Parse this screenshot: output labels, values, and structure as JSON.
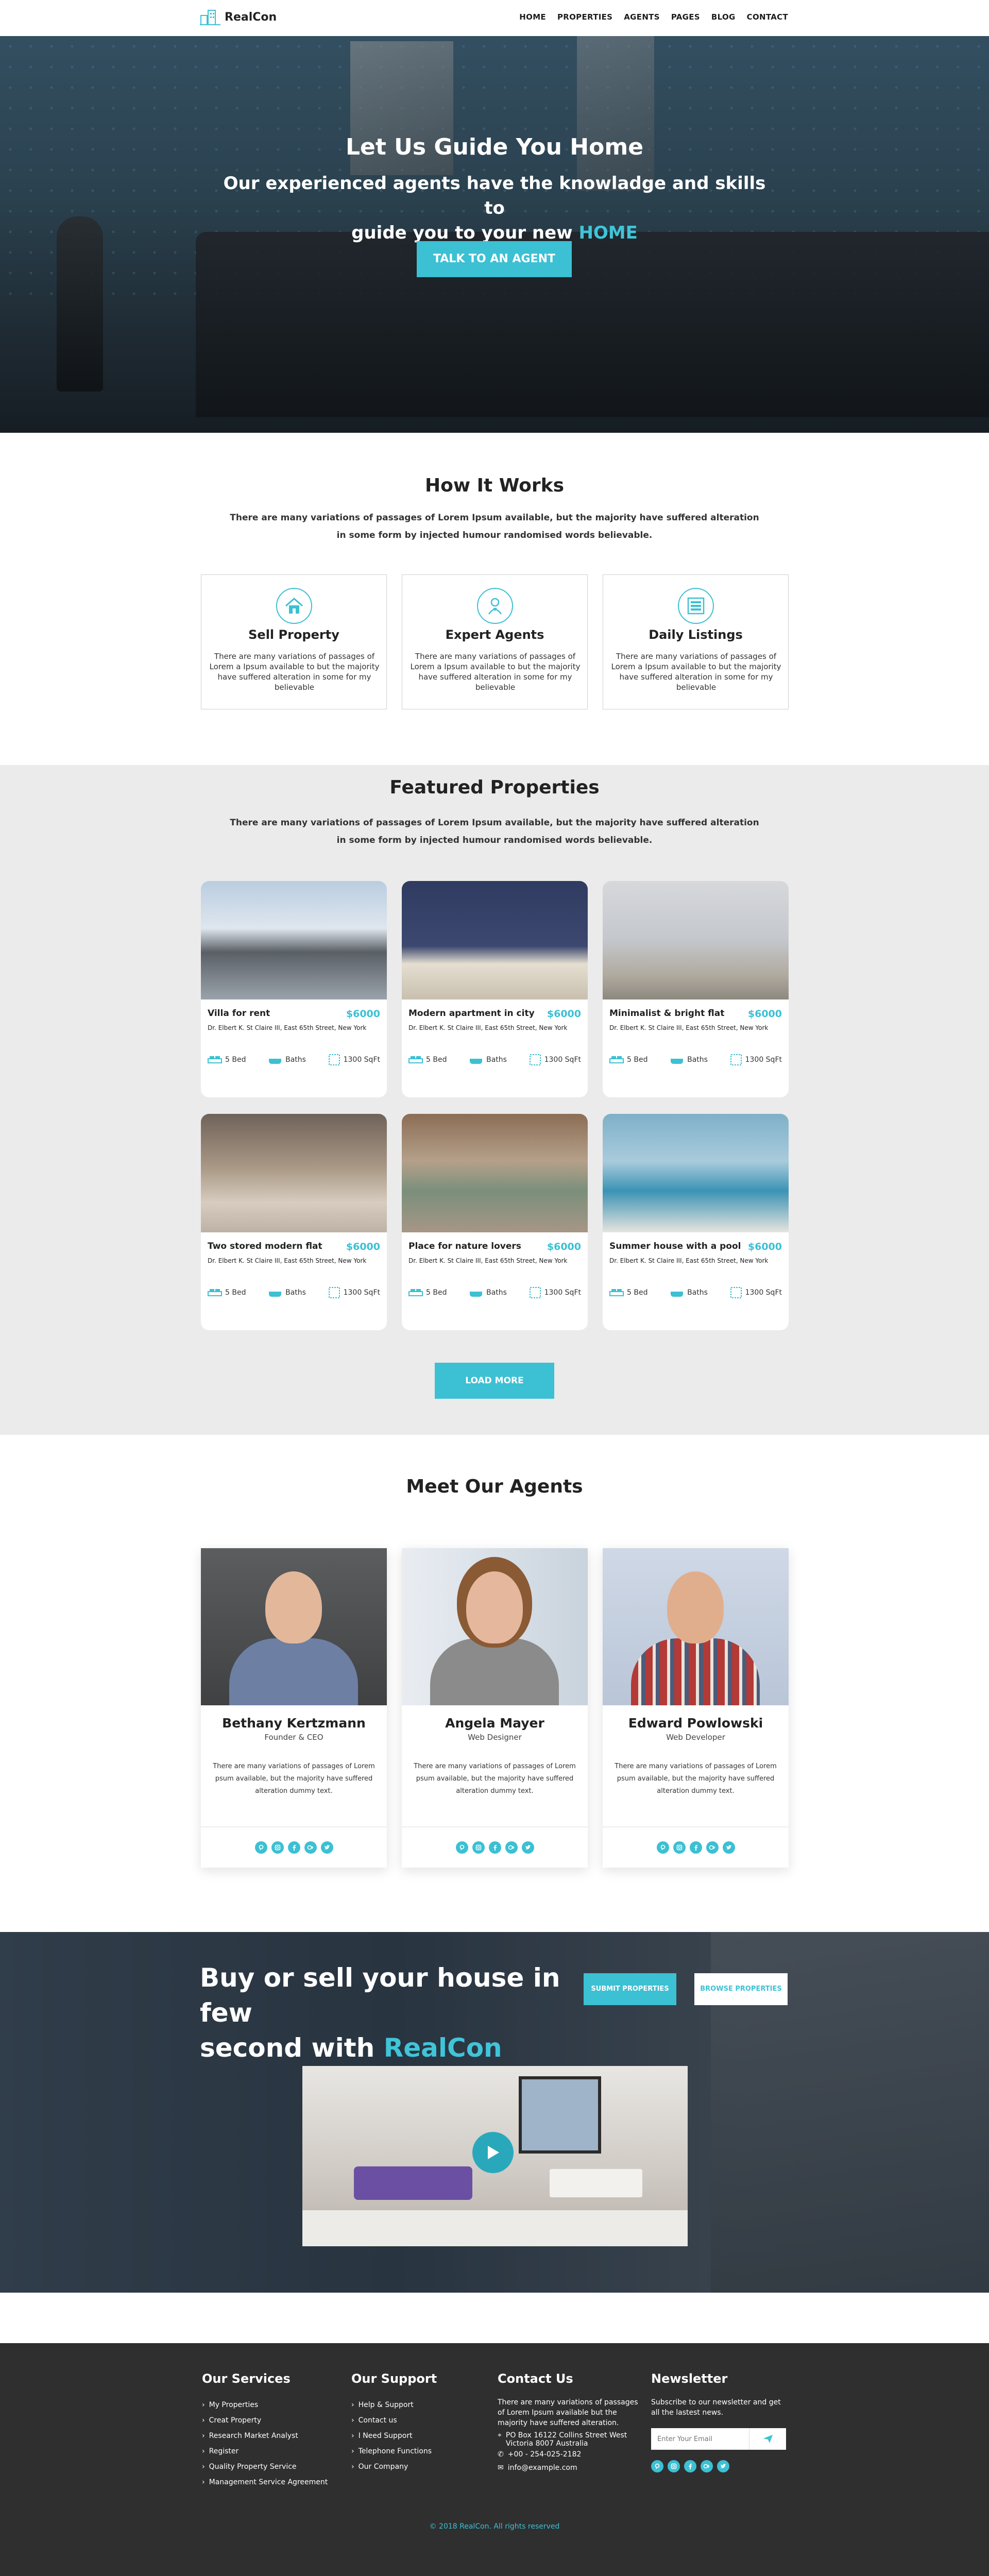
{
  "nav": {
    "brand": "RealCon",
    "items": [
      "HOME",
      "PROPERTIES",
      "AGENTS",
      "PAGES",
      "BLOG",
      "CONTACT"
    ]
  },
  "hero": {
    "title": "Let Us Guide You Home",
    "subtitle_line1": "Our experienced agents have the knowladge and skills to",
    "subtitle_line2_prefix": "guide you to your new",
    "subtitle_highlight": "HOME",
    "cta": "TALK TO AN AGENT"
  },
  "how": {
    "title": "How It Works",
    "description": "There are many variations of passages of Lorem Ipsum available, but the majority have suffered alteration in some form by injected humour randomised words believable.",
    "cards": [
      {
        "title": "Sell Property",
        "icon": "house-icon",
        "text": "There are many variations of passages of Lorem a Ipsum available to but the majority have suffered alteration in some for my believable"
      },
      {
        "title": "Expert Agents",
        "icon": "agent-icon",
        "text": "There are many variations of passages of Lorem a Ipsum available to but the majority have suffered alteration in some for my believable"
      },
      {
        "title": "Daily Listings",
        "icon": "listings-icon",
        "text": "There are many variations of passages of Lorem a Ipsum available to but the majority have suffered alteration in some for my believable"
      }
    ]
  },
  "featured": {
    "title": "Featured  Properties",
    "description": "There are many variations of passages of Lorem Ipsum available, but the majority have suffered alteration in some form by injected humour randomised words believable.",
    "load_more": "LOAD MORE",
    "properties": [
      {
        "name": "Villa for rent",
        "price": "$6000",
        "address": "Dr. Elbert K. St Claire III, East 65th Street, New York",
        "bed": "5 Bed",
        "baths": "Baths",
        "area": "1300 SqFt"
      },
      {
        "name": "Modern apartment in city",
        "price": "$6000",
        "address": "Dr. Elbert K. St Claire III, East 65th Street, New York",
        "bed": "5 Bed",
        "baths": "Baths",
        "area": "1300 SqFt"
      },
      {
        "name": "Minimalist & bright flat",
        "price": "$6000",
        "address": "Dr. Elbert K. St Claire III, East 65th Street, New York",
        "bed": "5 Bed",
        "baths": "Baths",
        "area": "1300 SqFt"
      },
      {
        "name": "Two stored modern flat",
        "price": "$6000",
        "address": "Dr. Elbert K. St Claire III, East 65th Street, New York",
        "bed": "5 Bed",
        "baths": "Baths",
        "area": "1300 SqFt"
      },
      {
        "name": "Place for nature lovers",
        "price": "$6000",
        "address": "Dr. Elbert K. St Claire III, East 65th Street, New York",
        "bed": "5 Bed",
        "baths": "Baths",
        "area": "1300 SqFt"
      },
      {
        "name": "Summer house with a pool",
        "price": "$6000",
        "address": "Dr. Elbert K. St Claire III, East 65th Street, New York",
        "bed": "5 Bed",
        "baths": "Baths",
        "area": "1300 SqFt"
      }
    ]
  },
  "agents": {
    "title": "Meet Our Agents",
    "list": [
      {
        "name": "Bethany Kertzmann",
        "role": "Founder & CEO",
        "bio": "There are many variations of passages of Lorem psum available, but the majority have suffered alteration dummy text."
      },
      {
        "name": "Angela Mayer",
        "role": "Web Designer",
        "bio": "There are many variations of passages of Lorem psum available, but the majority have suffered alteration dummy text."
      },
      {
        "name": "Edward Powlowski",
        "role": "Web Developer",
        "bio": "There are many variations of passages of Lorem psum available, but the majority have suffered alteration dummy text."
      }
    ],
    "social_icons": [
      "pinterest-icon",
      "instagram-icon",
      "facebook-icon",
      "google-plus-icon",
      "twitter-icon"
    ]
  },
  "promo": {
    "title_line1": "Buy or sell your house  in few",
    "title_line2_prefix": "second with",
    "title_highlight": "RealCon",
    "submit": "SUBMIT PROPERTIES",
    "browse": "BROWSE PROPERTIES"
  },
  "footer": {
    "services": {
      "title": "Our Services",
      "items": [
        "My Properties",
        "Creat Property",
        "Research Market Analyst",
        "Register",
        "Quality Property Service",
        "Management Service Agreement"
      ]
    },
    "support": {
      "title": "Our Support",
      "items": [
        "Help & Support",
        "Contact us",
        "I Need Support",
        "Telephone Functions",
        "Our Company"
      ]
    },
    "contact": {
      "title": "Contact Us",
      "text": "There are many variations of passages of Lorem Ipsum available but the majority have suffered alteration.",
      "address": "PO Box 16122 Collins Street West Victoria 8007 Australia",
      "phone": "+00 - 254-025-2182",
      "email": "info@example.com"
    },
    "newsletter": {
      "title": "Newsletter",
      "text": "Subscribe to our newsletter and get all the lastest news.",
      "placeholder": "Enter Your Email"
    },
    "copyright": "© 2018 RealCon. All rights reserved"
  },
  "colors": {
    "accent": "#3cc0d3",
    "footer_bg": "#2f2f30",
    "featured_bg": "#ebebeb"
  }
}
